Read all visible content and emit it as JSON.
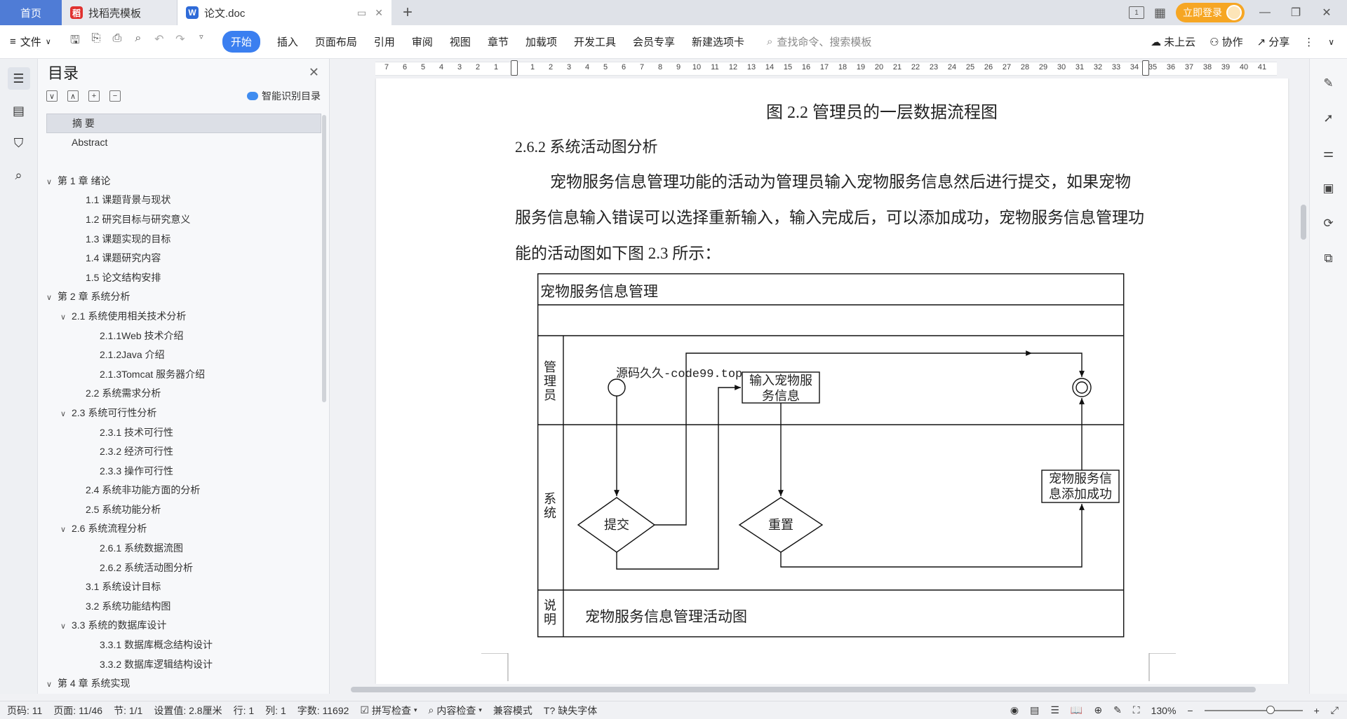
{
  "tabs": {
    "home": "首页",
    "template": "找稻壳模板",
    "doc": "论文.doc",
    "login": "立即登录"
  },
  "colors": {
    "accent": "#3b7ff0",
    "home_tab": "#4f7cd6",
    "template_icon": "#e0312f",
    "doc_icon": "#2f6bd8",
    "login": "#f6a623"
  },
  "ribbon": {
    "file": "文件",
    "items": [
      "开始",
      "插入",
      "页面布局",
      "引用",
      "审阅",
      "视图",
      "章节",
      "加载项",
      "开发工具",
      "会员专享",
      "新建选项卡"
    ],
    "search_placeholder": "查找命令、搜索模板",
    "cloud": "未上云",
    "collab": "协作",
    "share": "分享"
  },
  "toc": {
    "title": "目录",
    "smart": "智能识别目录",
    "items": [
      {
        "text": "摘  要",
        "level": 1,
        "selected": true,
        "caret": ""
      },
      {
        "text": "Abstract",
        "level": 1,
        "caret": ""
      },
      {
        "text": "",
        "level": 1,
        "caret": ""
      },
      {
        "text": "第 1 章  绪论",
        "level": 0,
        "caret": "v"
      },
      {
        "text": "1.1 课题背景与现状",
        "level": 2,
        "caret": ""
      },
      {
        "text": "1.2 研究目标与研究意义",
        "level": 2,
        "caret": ""
      },
      {
        "text": "1.3 课题实现的目标",
        "level": 2,
        "caret": ""
      },
      {
        "text": "1.4  课题研究内容",
        "level": 2,
        "caret": ""
      },
      {
        "text": "1.5  论文结构安排",
        "level": 2,
        "caret": ""
      },
      {
        "text": "第 2 章  系统分析",
        "level": 0,
        "caret": "v"
      },
      {
        "text": "2.1 系统使用相关技术分析",
        "level": 1,
        "caret": "v"
      },
      {
        "text": "2.1.1Web 技术介绍",
        "level": 3,
        "caret": ""
      },
      {
        "text": "2.1.2Java 介绍",
        "level": 3,
        "caret": ""
      },
      {
        "text": "2.1.3Tomcat 服务器介绍",
        "level": 3,
        "caret": ""
      },
      {
        "text": "2.2 系统需求分析",
        "level": 2,
        "caret": ""
      },
      {
        "text": "2.3 系统可行性分析",
        "level": 1,
        "caret": "v"
      },
      {
        "text": "2.3.1 技术可行性",
        "level": 3,
        "caret": ""
      },
      {
        "text": "2.3.2 经济可行性",
        "level": 3,
        "caret": ""
      },
      {
        "text": "2.3.3 操作可行性",
        "level": 3,
        "caret": ""
      },
      {
        "text": "2.4 系统非功能方面的分析",
        "level": 2,
        "caret": ""
      },
      {
        "text": "2.5 系统功能分析",
        "level": 2,
        "caret": ""
      },
      {
        "text": "2.6 系统流程分析",
        "level": 1,
        "caret": "v"
      },
      {
        "text": "2.6.1 系统数据流图",
        "level": 3,
        "caret": ""
      },
      {
        "text": "2.6.2 系统活动图分析",
        "level": 3,
        "caret": ""
      },
      {
        "text": "3.1 系统设计目标",
        "level": 2,
        "caret": ""
      },
      {
        "text": "3.2 系统功能结构图",
        "level": 2,
        "caret": ""
      },
      {
        "text": "3.3 系统的数据库设计",
        "level": 1,
        "caret": "v"
      },
      {
        "text": "3.3.1 数据库概念结构设计",
        "level": 3,
        "caret": ""
      },
      {
        "text": "3.3.2 数据库逻辑结构设计",
        "level": 3,
        "caret": ""
      },
      {
        "text": "第 4 章  系统实现",
        "level": 0,
        "caret": "v"
      }
    ]
  },
  "ruler": {
    "left": [
      7,
      6,
      5,
      4,
      3,
      2,
      1
    ],
    "right": [
      1,
      2,
      3,
      4,
      5,
      6,
      7,
      8,
      9,
      10,
      11,
      12,
      13,
      14,
      15,
      16,
      17,
      18,
      19,
      20,
      21,
      22,
      23,
      24,
      25,
      26,
      27,
      28,
      29,
      30,
      31,
      32,
      33,
      34,
      35,
      36,
      37,
      38,
      39,
      40,
      41
    ]
  },
  "doc": {
    "figure_caption": "图 2.2 管理员的一层数据流程图",
    "section_heading": "2.6.2 系统活动图分析",
    "paragraph": "宠物服务信息管理功能的活动为管理员输入宠物服务信息然后进行提交，如果宠物服务信息输入错误可以选择重新输入，输入完成后，可以添加成功，宠物服务信息管理功能的活动图如下图 2.3 所示：",
    "diagram": {
      "title": "宠物服务信息管理",
      "lane_admin": "管理员",
      "lane_system": "系统",
      "lane_note": "说明",
      "input_box": "输入宠物服务信息",
      "submit": "提交",
      "reset": "重置",
      "success_box": "宠物服务信息添加成功",
      "note": "宠物服务信息管理活动图",
      "watermark": "源码久久-code99.top"
    }
  },
  "status": {
    "page_code": "页码: 11",
    "page": "页面: 11/46",
    "section": "节: 1/1",
    "setting": "设置值: 2.8厘米",
    "row": "行: 1",
    "col": "列: 1",
    "words": "字数: 11692",
    "spell": "拼写检查",
    "content": "内容检查",
    "compat": "兼容模式",
    "missing_font": "缺失字体",
    "zoom": "130%"
  }
}
